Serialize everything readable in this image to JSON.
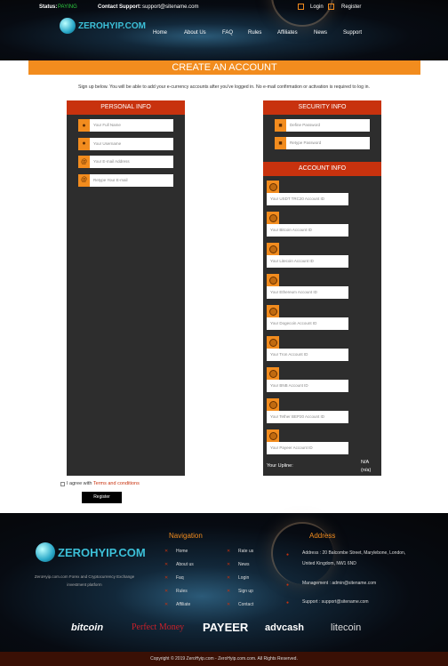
{
  "header": {
    "status_label": "Status:",
    "status_value": "PAYING",
    "contact_label": "Contact Support:",
    "contact_email": "support@sitename.com",
    "login": "Login",
    "register": "Register",
    "logo": "ZEROHYIP.COM",
    "nav": [
      "Home",
      "About Us",
      "FAQ",
      "Rules",
      "Affiliates",
      "News",
      "Support"
    ]
  },
  "banner": {
    "title": "CREATE AN ACCOUNT"
  },
  "intro": "Sign up below. You will be able to add your e-currency accounts after you've logged in. No e-mail confirmation or activation is required to log in.",
  "personal": {
    "title": "PERSONAL INFO",
    "fields": [
      {
        "icon": "user-icon",
        "placeholder": "Your Full Name"
      },
      {
        "icon": "user-icon",
        "placeholder": "Your Username"
      },
      {
        "icon": "at-icon",
        "placeholder": "Your E-mail Address"
      },
      {
        "icon": "at-icon",
        "placeholder": "Retype Your E-mail"
      }
    ]
  },
  "security": {
    "title": "SECURITY INFO",
    "fields": [
      {
        "icon": "lock-icon",
        "placeholder": "Define Password"
      },
      {
        "icon": "lock-icon",
        "placeholder": "Retype Password"
      }
    ]
  },
  "account": {
    "title": "ACCOUNT INFO",
    "fields": [
      "Your USDT TRC20 Account ID",
      "Your Bitcoin Account ID",
      "Your Litecoin Account ID",
      "Your Ethereum Account ID",
      "Your Dogecoin Account ID",
      "Your Tron Account ID",
      "Your BNB Account ID",
      "Your Tether BEP20 Account ID",
      "Your Payeer Account ID"
    ],
    "upline_label": "Your Upline:",
    "upline_value": "N/A",
    "upline_sub": "(n/a)"
  },
  "agree": {
    "text": "I agree with ",
    "link": "Terms and conditions"
  },
  "register_button": "Register",
  "footer": {
    "logo": "ZEROHYIP.COM",
    "tagline1": "ZeroHyip.com.com Forex and Cryptocurrency Exchange",
    "tagline2": "investment platform",
    "nav_title": "Navigation",
    "nav_col1": [
      "Home",
      "About us",
      "Faq",
      "Rules",
      "Affiliate"
    ],
    "nav_col2": [
      "Rate us",
      "News",
      "Login",
      "Sign up",
      "Contact"
    ],
    "address_title": "Address",
    "address1": "Address : 20 Balcombe Street, Marylebone, London,",
    "address2": "United Kingdom, NW1 6ND",
    "management": "Management : admin@sitename.com",
    "support": "Support : support@sitename.com",
    "payments": [
      "bitcoin",
      "Perfect Money",
      "PAYEER",
      "advcash",
      "litecoin"
    ],
    "copyright": "Copyright © 2019 ZeroHyip.com - ZeroHyip.com.com. All Rights Reserved."
  },
  "colors": {
    "accent": "#f28c1e",
    "panel_header": "#c8320e",
    "panel_bg": "#2d2d2d",
    "status": "#2ecc40"
  }
}
